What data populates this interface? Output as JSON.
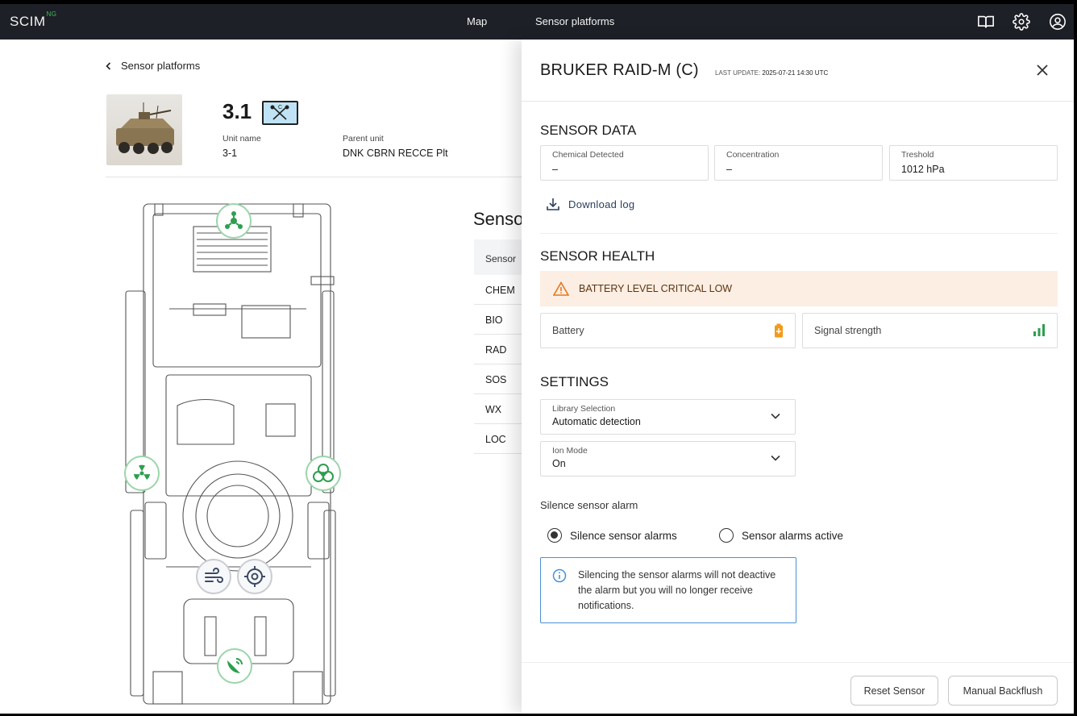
{
  "app": {
    "logo": "SCIM",
    "logo_sup": "NG",
    "nav": [
      "Map",
      "Sensor platforms"
    ],
    "icons": [
      "manual-book-icon",
      "gear-icon",
      "user-account-icon"
    ]
  },
  "page": {
    "back_label": "Sensor platforms",
    "unit_title": "3.1",
    "unit_name_label": "Unit name",
    "unit_name": "3-1",
    "parent_unit_label": "Parent unit",
    "parent_unit": "DNK CBRN RECCE Plt",
    "sensor_section_title": "Senso",
    "sensor_table_header": "Sensor",
    "sensors": [
      "CHEM",
      "BIO",
      "RAD",
      "SOS",
      "WX",
      "LOC"
    ]
  },
  "panel": {
    "title": "BRUKER RAID-M (C)",
    "last_update_label": "LAST UPDATE:",
    "last_update_value": "2025-07-21 14:30 UTC",
    "sensor_data_title": "SENSOR DATA",
    "data": [
      {
        "label": "Chemical Detected",
        "value": "–"
      },
      {
        "label": "Concentration",
        "value": "–"
      },
      {
        "label": "Treshold",
        "value": "1012 hPa"
      }
    ],
    "download_label": "Download log",
    "sensor_health_title": "SENSOR HEALTH",
    "alert_text": "BATTERY LEVEL CRITICAL LOW",
    "battery_label": "Battery",
    "signal_label": "Signal strength",
    "settings_title": "SETTINGS",
    "library_label": "Library Selection",
    "library_value": "Automatic detection",
    "ion_label": "Ion Mode",
    "ion_value": "On",
    "silence_title": "Silence sensor alarm",
    "radio_silence": "Silence sensor alarms",
    "radio_active": "Sensor alarms active",
    "radio_selected": "silence",
    "info_text": "Silencing the sensor alarms will not deactive the alarm but you will no longer receive notifications.",
    "reset_button": "Reset Sensor",
    "backflush_button": "Manual Backflush",
    "colors": {
      "alert_bg": "#fdeee3",
      "warning": "#e3761e",
      "battery": "#f29a1a",
      "signal": "#2e9e4f",
      "info_border": "#4a90d9"
    }
  }
}
